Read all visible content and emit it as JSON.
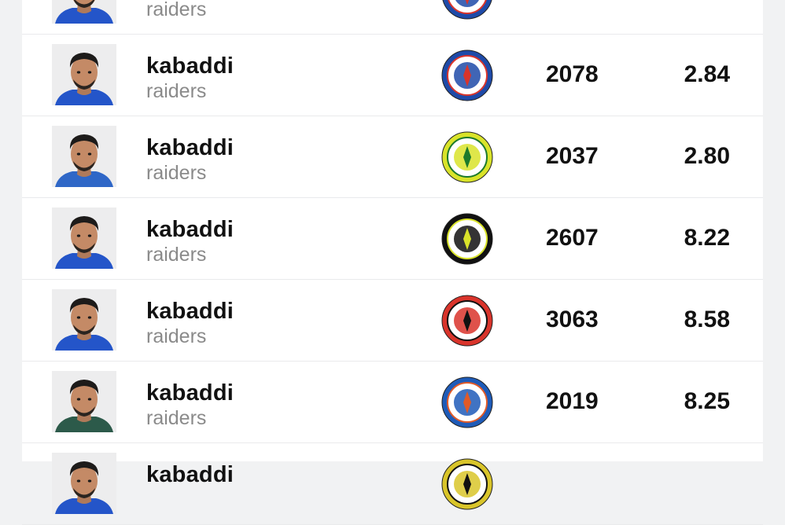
{
  "players": [
    {
      "name": "kabaddi",
      "team": "raiders",
      "points": "",
      "average": "",
      "logo_color": "#1e4aa8",
      "logo_accent": "#d9342b",
      "shirt": "#2455c9"
    },
    {
      "name": "kabaddi",
      "team": "raiders",
      "points": "2078",
      "average": "2.84",
      "logo_color": "#1e4aa8",
      "logo_accent": "#d9342b",
      "shirt": "#2455c9"
    },
    {
      "name": "kabaddi",
      "team": "raiders",
      "points": "2037",
      "average": "2.80",
      "logo_color": "#d9e32a",
      "logo_accent": "#1c7a2b",
      "shirt": "#2f67c7"
    },
    {
      "name": "kabaddi",
      "team": "raiders",
      "points": "2607",
      "average": "8.22",
      "logo_color": "#111111",
      "logo_accent": "#d9e32a",
      "shirt": "#2455c9"
    },
    {
      "name": "kabaddi",
      "team": "raiders",
      "points": "3063",
      "average": "8.58",
      "logo_color": "#d9342b",
      "logo_accent": "#111111",
      "shirt": "#2455c9"
    },
    {
      "name": "kabaddi",
      "team": "raiders",
      "points": "2019",
      "average": "8.25",
      "logo_color": "#1e5bb8",
      "logo_accent": "#e05a28",
      "shirt": "#2c5a4a"
    },
    {
      "name": "kabaddi",
      "team": "",
      "points": "",
      "average": "",
      "logo_color": "#d9c52a",
      "logo_accent": "#111111",
      "shirt": "#2455c9"
    }
  ]
}
